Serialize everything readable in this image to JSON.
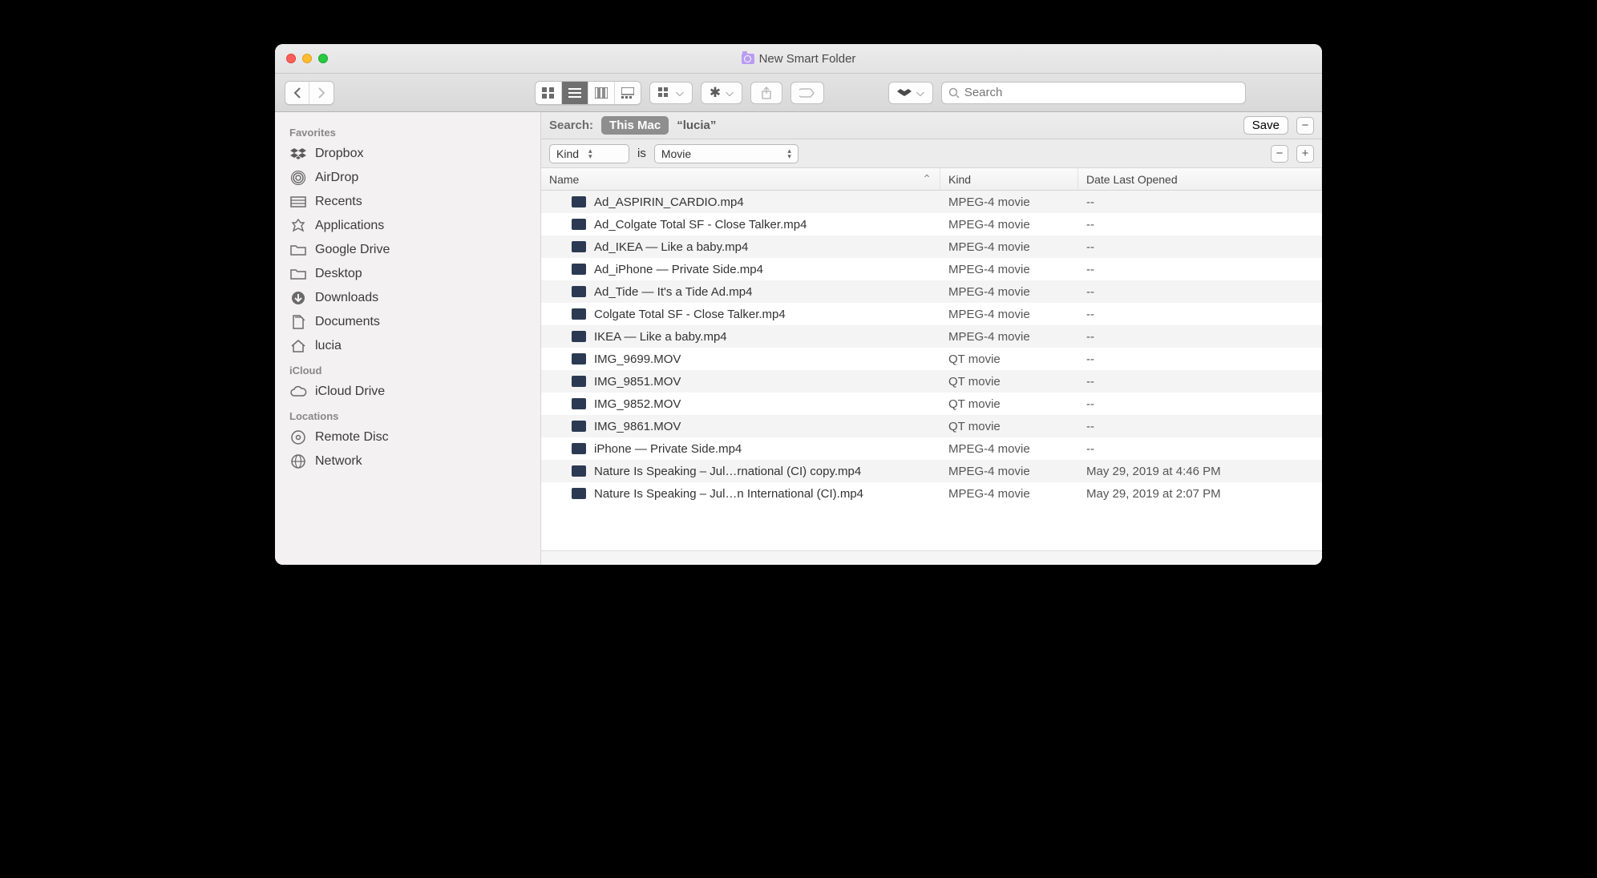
{
  "window": {
    "title": "New Smart Folder"
  },
  "toolbar": {
    "search_placeholder": "Search"
  },
  "sidebar": {
    "sections": [
      {
        "heading": "Favorites",
        "items": [
          {
            "icon": "dropbox",
            "label": "Dropbox"
          },
          {
            "icon": "airdrop",
            "label": "AirDrop"
          },
          {
            "icon": "recents",
            "label": "Recents"
          },
          {
            "icon": "apps",
            "label": "Applications"
          },
          {
            "icon": "folder",
            "label": "Google Drive"
          },
          {
            "icon": "folder",
            "label": "Desktop"
          },
          {
            "icon": "downloads",
            "label": "Downloads"
          },
          {
            "icon": "documents",
            "label": "Documents"
          },
          {
            "icon": "home",
            "label": "lucia"
          }
        ]
      },
      {
        "heading": "iCloud",
        "items": [
          {
            "icon": "icloud",
            "label": "iCloud Drive"
          }
        ]
      },
      {
        "heading": "Locations",
        "items": [
          {
            "icon": "disc",
            "label": "Remote Disc"
          },
          {
            "icon": "network",
            "label": "Network"
          }
        ]
      }
    ]
  },
  "scope": {
    "label": "Search:",
    "scope_active": "This Mac",
    "scope_other": "“lucia”",
    "save_label": "Save"
  },
  "criteria": {
    "attribute": "Kind",
    "op": "is",
    "value": "Movie"
  },
  "columns": {
    "name": "Name",
    "kind": "Kind",
    "date": "Date Last Opened"
  },
  "files": [
    {
      "name": "Ad_ASPIRIN_CARDIO.mp4",
      "kind": "MPEG-4 movie",
      "date": "--"
    },
    {
      "name": "Ad_Colgate Total SF - Close Talker.mp4",
      "kind": "MPEG-4 movie",
      "date": "--"
    },
    {
      "name": "Ad_IKEA — Like a baby.mp4",
      "kind": "MPEG-4 movie",
      "date": "--"
    },
    {
      "name": "Ad_iPhone — Private Side.mp4",
      "kind": "MPEG-4 movie",
      "date": "--"
    },
    {
      "name": "Ad_Tide — It's a Tide Ad.mp4",
      "kind": "MPEG-4 movie",
      "date": "--"
    },
    {
      "name": "Colgate Total SF - Close Talker.mp4",
      "kind": "MPEG-4 movie",
      "date": "--"
    },
    {
      "name": "IKEA — Like a baby.mp4",
      "kind": "MPEG-4 movie",
      "date": "--"
    },
    {
      "name": "IMG_9699.MOV",
      "kind": "QT movie",
      "date": "--"
    },
    {
      "name": "IMG_9851.MOV",
      "kind": "QT movie",
      "date": "--"
    },
    {
      "name": "IMG_9852.MOV",
      "kind": "QT movie",
      "date": "--"
    },
    {
      "name": "IMG_9861.MOV",
      "kind": "QT movie",
      "date": "--"
    },
    {
      "name": "iPhone — Private Side.mp4",
      "kind": "MPEG-4 movie",
      "date": "--"
    },
    {
      "name": "Nature Is Speaking – Jul…rnational (CI) copy.mp4",
      "kind": "MPEG-4 movie",
      "date": "May 29, 2019 at 4:46 PM"
    },
    {
      "name": "Nature Is Speaking – Jul…n International (CI).mp4",
      "kind": "MPEG-4 movie",
      "date": "May 29, 2019 at 2:07 PM"
    }
  ]
}
